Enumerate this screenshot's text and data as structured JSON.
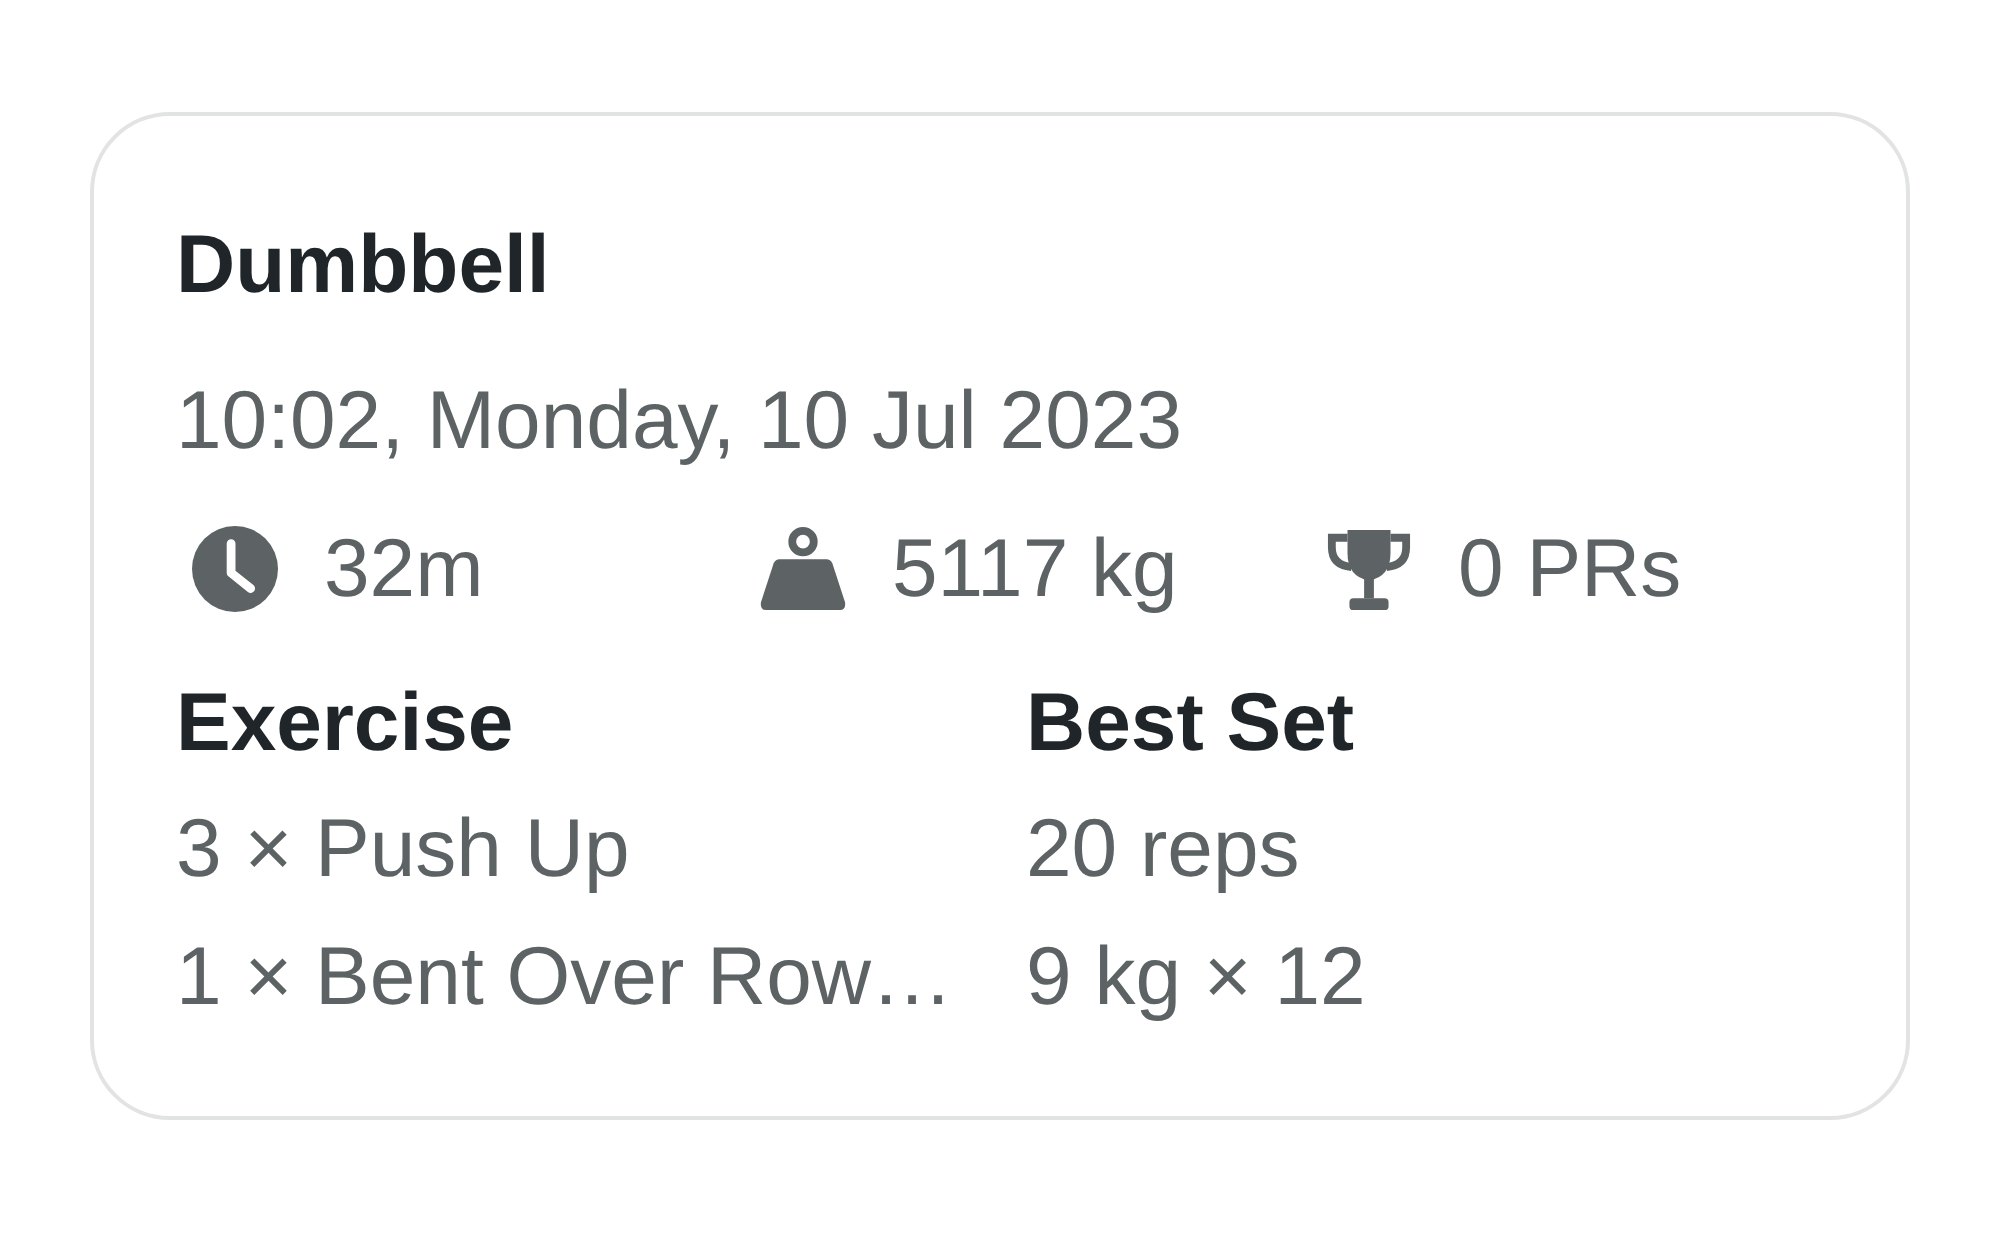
{
  "card": {
    "title": "Dumbbell",
    "datetime": "10:02, Monday, 10 Jul 2023",
    "stats": [
      {
        "kind": "duration",
        "value": "32m"
      },
      {
        "kind": "volume",
        "value": "5117 kg"
      },
      {
        "kind": "records",
        "value": "0 PRs"
      }
    ],
    "table": {
      "columns": [
        "Exercise",
        "Best Set"
      ],
      "rows": [
        [
          "3 × Push Up",
          "20 reps"
        ],
        [
          "1 × Bent Over Row…",
          "9 kg × 12"
        ]
      ]
    }
  }
}
